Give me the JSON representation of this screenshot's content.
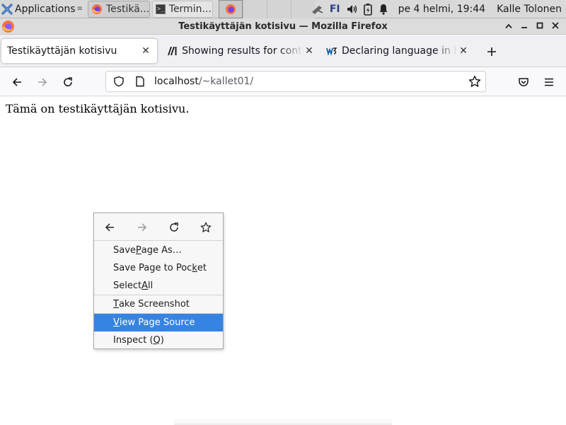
{
  "panel": {
    "applications_label": "Applications",
    "tasks": [
      {
        "label": "Testikä...",
        "icon": "firefox-icon"
      },
      {
        "label": "Termin...",
        "icon": "terminal-icon"
      }
    ],
    "keyboard_layout": "FI",
    "clock": "pe  4 helmi, 19:44",
    "user": "Kalle Tolonen"
  },
  "window": {
    "title": "Testikäyttäjän kotisivu — Mozilla Firefox"
  },
  "tabs": [
    {
      "label": "Testikäyttäjän kotisivu",
      "icon": "none"
    },
    {
      "label": "Showing results for conte",
      "icon": "mdn-icon"
    },
    {
      "label": "Declaring language in HT",
      "icon": "w3c-icon"
    }
  ],
  "urlbar": {
    "host": "localhost",
    "path": "/~kallet01/"
  },
  "page": {
    "text": "Tämä on testikäyttäjän kotisivu."
  },
  "context_menu": {
    "items": [
      {
        "pre": "Save ",
        "key": "P",
        "post": "age As…"
      },
      {
        "pre": "Save Page to Poc",
        "key": "k",
        "post": "et"
      },
      {
        "pre": "Select ",
        "key": "A",
        "post": "ll"
      },
      {
        "pre": "",
        "key": "T",
        "post": "ake Screenshot"
      },
      {
        "pre": "",
        "key": "V",
        "post": "iew Page Source"
      },
      {
        "pre": "Inspect (",
        "key": "Q",
        "post": ")"
      }
    ],
    "highlighted": "View Page Source"
  },
  "colors": {
    "highlight": "#3584e4",
    "keyboard_layout": "#2b3f86"
  }
}
